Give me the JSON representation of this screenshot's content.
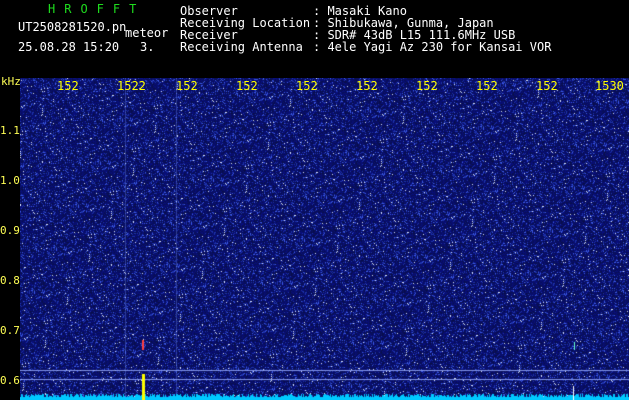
{
  "app": {
    "title": "HROFFT",
    "filename": "UT2508281520.pn",
    "mode": "meteor",
    "datetime": "25.08.28 15:20",
    "count": "3."
  },
  "info": [
    {
      "label": "Observer",
      "value": ": Masaki Kano"
    },
    {
      "label": "Receiving Location",
      "value": ": Shibukawa, Gunma, Japan"
    },
    {
      "label": "Receiver",
      "value": ": SDR# 43dB L15 111.6MHz USB"
    },
    {
      "label": "Receiving Antenna",
      "value": ": 4ele Yagi Az 230 for Kansai VOR"
    }
  ],
  "axis": {
    "y_unit": "kHz",
    "x_ticks": [
      "152",
      "1522",
      "152",
      "152",
      "152",
      "152",
      "152",
      "152",
      "152",
      "1530"
    ],
    "y_ticks": [
      "1.1",
      "1.0",
      "0.9",
      "0.8",
      "0.7",
      "0.6"
    ]
  },
  "colors": {
    "background": "#000000",
    "noise": "#1c2f9a",
    "noise_bright": "#ffffff",
    "baseline": "#00c8ff",
    "title": "#1edc1e",
    "axis_text": "#ffff00",
    "meteor_trace": "#ff4040",
    "marker": "#ffff00"
  }
}
